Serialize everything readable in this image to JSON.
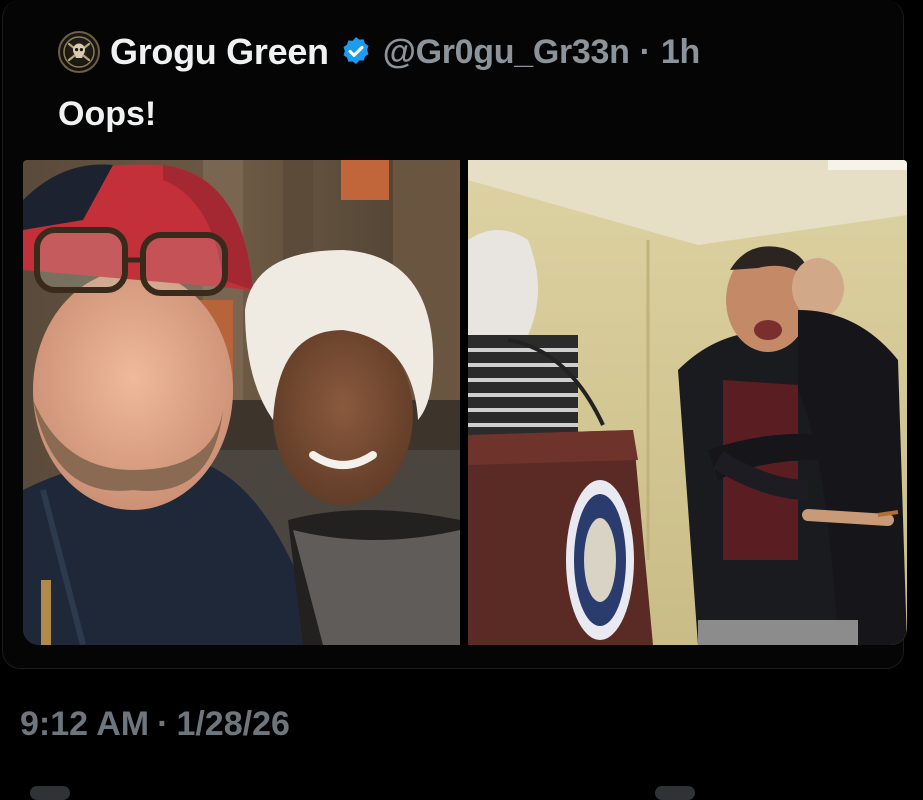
{
  "post": {
    "author": {
      "display_name": "Grogu Green",
      "handle": "@Gr0gu_Gr33n",
      "age": "1h",
      "separator": "·",
      "verified": true,
      "avatar_icon": "skull-emblem-icon",
      "verified_icon": "verified-badge-icon"
    },
    "text": "Oops!",
    "media": [
      {
        "kind": "photo",
        "description_icon": "selfie-photo"
      },
      {
        "kind": "photo",
        "description_icon": "podium-scuffle-photo"
      }
    ]
  },
  "footer": {
    "time": "9:12 AM",
    "separator": "·",
    "date": "1/28/26"
  },
  "colors": {
    "background": "#000000",
    "primary_text": "#f0f1f2",
    "secondary_text": "#8b949b",
    "timestamp_text": "#6e767d",
    "verified_blue": "#1d9bf0"
  }
}
